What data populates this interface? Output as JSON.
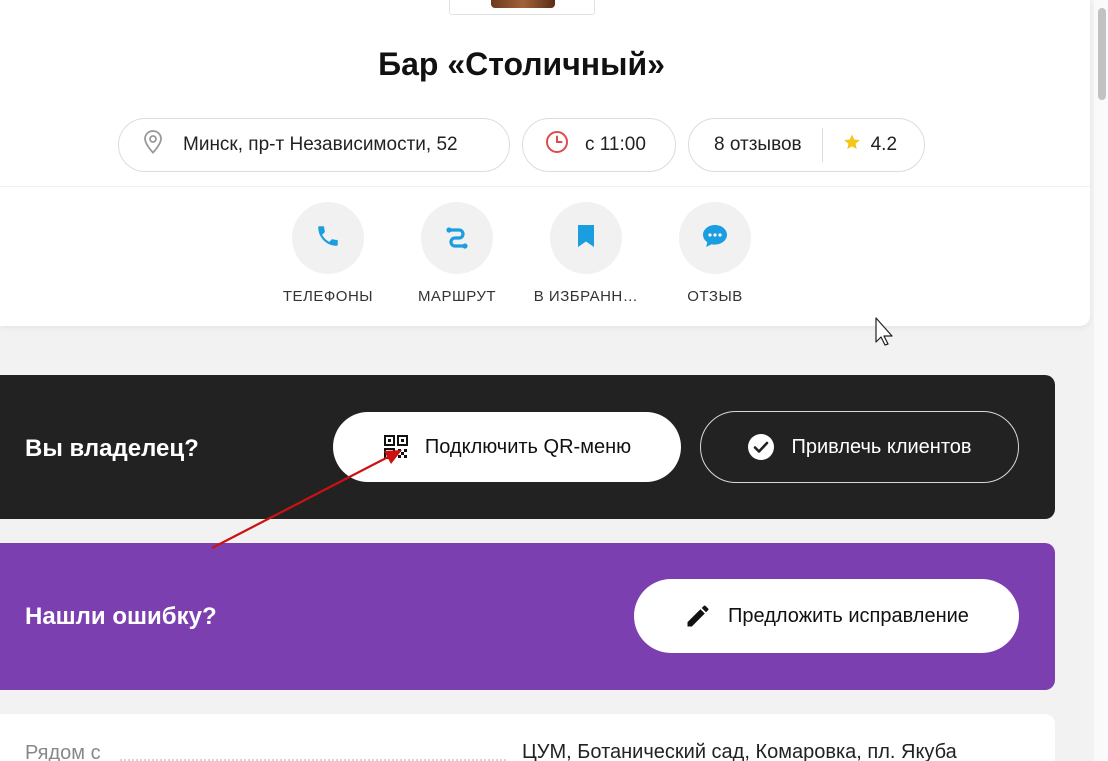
{
  "venue": {
    "title": "Бар «Столичный»",
    "address": "Минск, пр-т Независимости, 52",
    "hours": "с 11:00",
    "reviews": "8 отзывов",
    "rating": "4.2"
  },
  "actions": [
    {
      "label": "ТЕЛЕФОНЫ",
      "icon": "phone-icon"
    },
    {
      "label": "МАРШРУТ",
      "icon": "route-icon"
    },
    {
      "label": "В ИЗБРАНН…",
      "icon": "bookmark-icon"
    },
    {
      "label": "ОТЗЫВ",
      "icon": "chat-bubble-icon"
    }
  ],
  "owner": {
    "heading": "Вы владелец?",
    "qr_button": "Подключить QR-меню",
    "clients_button": "Привлечь клиентов"
  },
  "error": {
    "heading": "Нашли ошибку?",
    "suggest_button": "Предложить исправление"
  },
  "nearby": {
    "label": "Рядом с",
    "value": "ЦУМ, Ботанический сад, Комаровка, пл. Якуба"
  },
  "colors": {
    "accent_blue": "#1a9ee0",
    "owner_bg": "#222222",
    "error_bg": "#7b3fb0",
    "clock_red": "#e04a4a",
    "star_gold": "#f5c518",
    "annotation_arrow": "#cc1111"
  }
}
